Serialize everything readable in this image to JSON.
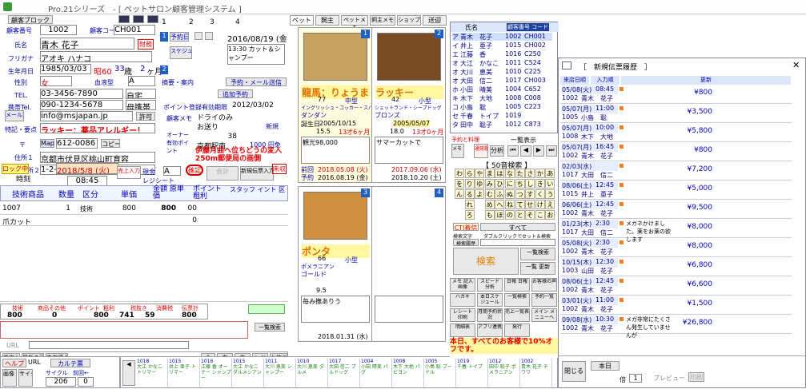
{
  "app": {
    "title": "Pro.21シリーズ　- [ ペットサロン顧客管理システム ]"
  },
  "customer": {
    "block_btn": "顧客ブロック",
    "id_label": "顧客番号",
    "id": "1002",
    "code_label": "顧客コード",
    "code": "CH001",
    "name_label": "氏名",
    "name": "青木 花子",
    "sex_badge": "財務",
    "furigana_label": "フリガナ",
    "furigana": "アオキ ハナコ",
    "birth_label": "生年月日",
    "birth": "1985/03/03",
    "era": "昭60",
    "age": "33",
    "age_unit": "歳",
    "months": "2",
    "months_unit": "ヶ月",
    "gender_label": "性別",
    "gender": "女",
    "blood_label": "血液型",
    "blood": "A",
    "tel_label": "TEL.",
    "tel": "03-3456-7890",
    "tel_type": "自宅",
    "mobile_label": "携帯Tel.",
    "mobile": "090-1234-5678",
    "mobile_type": "母携帯",
    "mail_label": "メール送信",
    "mail": "info@msjapan.jp",
    "mail_flag": "許可",
    "note_label": "特記・要点",
    "note": "ラッキー：薬品アレルギー！",
    "zip_label": "〒",
    "zip_btn": "Map",
    "zip": "612-0086",
    "copy_btn": "コピー",
    "addr1_label": "住所１",
    "addr1": "京都市伏見区桃山町育容",
    "addr2_label": "住所２",
    "addr2": "1-2-3"
  },
  "tabs": [
    "1",
    "2",
    "3",
    "4"
  ],
  "reservation": {
    "num": "1",
    "label": "予約日付",
    "date": "2016/08/19 (金)",
    "time": "13:30 カット＆シャンプー",
    "schedule_label": "スケジュール全体",
    "num2": "2",
    "comment_label": "摘要・案内",
    "mail_btn": "予約・メール送信",
    "add_btn": "追加予約",
    "point_label": "ポイント登録",
    "point_card": "有効期限",
    "point_date": "2012/03/02",
    "cust_memo_label": "顧客メモ",
    "memo1": "ドライのみ",
    "memo2": "お送り",
    "memo_new": "新規",
    "pt_label": "オーナー有効ポイント",
    "pt_value": "38",
    "pt_yen": "1000 円免",
    "shop_label": "京都駅南",
    "promo": "伊藤月曲へ位ちどうの変入250m郵便局の画側"
  },
  "visit": {
    "checkbox": "ロック中",
    "time_label": "時刻",
    "date": "2018/5/8 (火)",
    "time": "08:45",
    "sales_btn": "売上入力",
    "cash": "現金",
    "staff": "A",
    "receipt": "レジシート",
    "card_btn": "確認",
    "sold_btn": "会計",
    "new_btn": "新規伝票入力",
    "unprint": "未収"
  },
  "sales_table": {
    "headers": [
      "技術商品",
      "数量",
      "区分",
      "単価",
      "金額 原単価",
      "ポイント 粗利",
      "スタッフ イント 区"
    ],
    "rows": [
      {
        "code": "1007",
        "qty": "1",
        "cat": "技術",
        "price": "800",
        "amount": "800",
        "pt": "00"
      },
      {
        "name": "爪カット",
        "pt": "0"
      }
    ]
  },
  "totals": {
    "labels": [
      "技術",
      "商品その他",
      "ポイント",
      "粗利",
      "税抜き",
      "消費税",
      "伝票計"
    ],
    "values": [
      "800",
      "0",
      "800",
      "741",
      "59",
      "800"
    ],
    "extra": "一覧検索"
  },
  "pets_tabs": [
    "ペット",
    "飼主",
    "ペットメモ",
    "飼主メモ",
    "ショップ",
    "送迎"
  ],
  "pets": [
    {
      "num": "1",
      "name": "龍馬：りょうま",
      "kind": "中型",
      "breed": "イングリッシュ・コッカー・スパニエル",
      "color": "ダンダン",
      "weight": "77",
      "age_lbl": "誕生日",
      "birth": "2005/10/15",
      "age": "15.5",
      "age_y": "13才6ヶ月",
      "memo": "観光98,000",
      "visit_lbl": "前回",
      "last": "2018.05.08 (火)",
      "next_lbl": "予約",
      "next": "2016.08.19 (金)"
    },
    {
      "num": "2",
      "name": "ラッキー",
      "kind": "小型",
      "breed": "シェットランド・シープドッグ",
      "color": "ブロンズ",
      "weight": "42",
      "birth": "2005/05/07",
      "age": "18.0",
      "age_y": "13才0ヶ月",
      "memo": "サマーカットで",
      "last": "2017.09.06 (水)",
      "next": "2018.10.20 (土)"
    },
    {
      "num": "3",
      "name": "ポンタ",
      "kind": "小型",
      "breed": "ポメラニアン",
      "color": "ゴールド",
      "weight": "66",
      "birth": "",
      "age": "9.5",
      "memo": "毎み撫ありう",
      "last": "2018.01.31 (水)",
      "next": ""
    },
    {
      "num": "4",
      "name": "",
      "kind": "",
      "breed": "",
      "color": "",
      "weight": "",
      "birth": "",
      "age": "",
      "memo": "",
      "last": "",
      "next": ""
    }
  ],
  "customer_list": {
    "header_name": "氏名",
    "header_no": "顧客番号",
    "header_code": "コード",
    "rows": [
      {
        "k": "ア",
        "name": "青木　花子",
        "no": "1002",
        "code": "CH001"
      },
      {
        "k": "イ",
        "name": "井上　亜子",
        "no": "1015",
        "code": "CH002"
      },
      {
        "k": "エ",
        "name": "江藤　香",
        "no": "1016",
        "code": "C250"
      },
      {
        "k": "オ",
        "name": "大江　かなこ",
        "no": "1011",
        "code": "C524"
      },
      {
        "k": "オ",
        "name": "大川　恵美",
        "no": "1010",
        "code": "C225"
      },
      {
        "k": "オ",
        "name": "大田　信二",
        "no": "1017",
        "code": "CH003"
      },
      {
        "k": "ホ",
        "name": "小田　晴美",
        "no": "1004",
        "code": "C652"
      },
      {
        "k": "キ",
        "name": "木下　大地",
        "no": "1008",
        "code": "C008"
      },
      {
        "k": "コ",
        "name": "小島　聡",
        "no": "1005",
        "code": "C223"
      },
      {
        "k": "セ",
        "name": "千春　トイプ",
        "no": "1019",
        "code": ""
      },
      {
        "k": "タ",
        "name": "田中　聡子",
        "no": "1012",
        "code": "C873"
      }
    ]
  },
  "navigator": {
    "all_btn": "一覧表示",
    "reserve_label": "予約と料理",
    "memo_btn": "メモ 保存",
    "search_cond": "通常履歴検索",
    "analysis": "分析",
    "kana_title": "【 50音検索 】",
    "kana_rows": [
      [
        "わ",
        "ら",
        "や",
        "ま",
        "は",
        "な",
        "た",
        "さ",
        "か",
        "あ"
      ],
      [
        "を",
        "り",
        "ゆ",
        "み",
        "ひ",
        "に",
        "ち",
        "し",
        "き",
        "い"
      ],
      [
        "ん",
        "る",
        "よ",
        "む",
        "ふ",
        "ぬ",
        "つ",
        "す",
        "く",
        "う"
      ],
      [
        "",
        "れ",
        "",
        "め",
        "へ",
        "ね",
        "て",
        "せ",
        "け",
        "え"
      ],
      [
        "",
        "ろ",
        "",
        "も",
        "ほ",
        "の",
        "と",
        "そ",
        "こ",
        "お"
      ]
    ],
    "ctm_btn": "CTI着信",
    "all_kana": "すべて",
    "search_opt": "検索文字",
    "dbl_click": "ダブルクリックでセット＆検索",
    "search_hist": "検索履歴",
    "search_btn": "検索",
    "list_btn": "一覧検索",
    "list_hist": "一覧 更新",
    "menu": [
      "メモ 記入 画像",
      "スピード 分析",
      "日報 日報",
      "お客様の声",
      "ハガキ",
      "本日スケジュール",
      "一覧検索",
      "予約一覧",
      "レシート 印刷",
      "月間予約状況",
      "売上一覧表",
      "メイン メニューへ",
      "明細表",
      "アプリ連携",
      "発行"
    ],
    "promo": "本日、すべてのお客様で10%オフです。"
  },
  "history": {
    "title": "［　新規伝票履歴　］",
    "col_date": "来店日順",
    "col_in": "入力順",
    "col_update": "更新",
    "rows": [
      {
        "date": "05/08(火)",
        "time": "08:45",
        "no": "1002",
        "nm": "青木　花子",
        "amt": "¥800",
        "memo": ""
      },
      {
        "date": "05/07(月)",
        "time": "11:00",
        "no": "1005",
        "nm": "小島　聡",
        "amt": "¥3,500",
        "memo": ""
      },
      {
        "date": "05/07(月)",
        "time": "10:00",
        "no": "1008",
        "nm": "木下　大地",
        "amt": "¥5,800",
        "memo": ""
      },
      {
        "date": "05/07(月)",
        "time": "16:45",
        "no": "1002",
        "nm": "青木　花子",
        "amt": "¥800",
        "memo": ""
      },
      {
        "date": "02/03(水)",
        "time": "",
        "no": "1017",
        "nm": "大田　信二",
        "amt": "¥7,200",
        "memo": ""
      },
      {
        "date": "08/06(土)",
        "time": "12:45",
        "no": "1015",
        "nm": "井上　亜子",
        "amt": "¥5,000",
        "memo": ""
      },
      {
        "date": "06/06(土)",
        "time": "12:45",
        "no": "1002",
        "nm": "青木　花子",
        "amt": "¥9,500",
        "memo": ""
      },
      {
        "date": "01/23(木)",
        "time": "2:30",
        "no": "1017",
        "nm": "大田　信二",
        "amt": "¥8,000",
        "memo": "メガネかけました。薬をお薬の欲します"
      },
      {
        "date": "05/08(火)",
        "time": "2:30",
        "no": "1002",
        "nm": "青木　花子",
        "amt": "¥8,000",
        "memo": ""
      },
      {
        "date": "10/15(木)",
        "time": "12:30",
        "no": "1003",
        "nm": "山田　花子",
        "amt": "¥6,800",
        "memo": ""
      },
      {
        "date": "08/06(土)",
        "time": "12:45",
        "no": "1002",
        "nm": "青木　花子",
        "amt": "¥6,600",
        "memo": ""
      },
      {
        "date": "03/01(火)",
        "time": "11:00",
        "no": "1002",
        "nm": "青木　花子",
        "amt": "¥1,500",
        "memo": ""
      },
      {
        "date": "09/08(水)",
        "time": "10:30",
        "no": "1002",
        "nm": "青木　花子",
        "amt": "¥26,800",
        "memo": "メガ非常にたくさん発生していませんが"
      }
    ],
    "close_btn": "閉じる",
    "today_btn": "本日",
    "page_label": "倍",
    "page": "1",
    "preview": "プレビュー",
    "print": "印刷"
  },
  "bottom": {
    "help": "ヘルプ",
    "url": "URL",
    "card": "カルテ票",
    "cycle": "サイクル",
    "count_label": "前回←",
    "count": "206",
    "zero": "0",
    "tools": [
      "来店入力",
      "最新の画面",
      "来店順 補足",
      "画像 検索",
      "サイクル出力"
    ],
    "op_btns": [
      "レジ",
      "お釣り",
      "全",
      "通常",
      "小計",
      "右",
      "左",
      "二"
    ],
    "schedule": [
      {
        "no": "1018",
        "txt": "大江 かなこ トリマー"
      },
      {
        "no": "1015",
        "txt": "井上 亜子 トリマー"
      },
      {
        "no": "1016",
        "txt": "江藤 香 オーナー シャンプー"
      },
      {
        "no": "1015",
        "txt": "大江 かなこ ダルメシアン"
      },
      {
        "no": "1011",
        "txt": "大川 恵美 シャンプー"
      },
      {
        "no": "1010",
        "txt": "大川 恵美 ダルメ"
      },
      {
        "no": "1017",
        "txt": "大田 信二 ブルドッグ"
      },
      {
        "no": "1004",
        "txt": "小田 晴美 パグ"
      },
      {
        "no": "1008",
        "txt": "木下 大地 パピヨン"
      },
      {
        "no": "1005",
        "txt": "小島 聡 プードル"
      },
      {
        "no": "1019",
        "txt": "千春 トイプ"
      },
      {
        "no": "1012",
        "txt": "田中 聡子 ポメラニアン"
      },
      {
        "no": "1002",
        "txt": "青木 花子 チワワ"
      }
    ]
  },
  "colors": {
    "accent": "#0000c0",
    "hilite": "#fff6a0",
    "tabbg": "#dbe6fb",
    "warn": "#e00000"
  }
}
